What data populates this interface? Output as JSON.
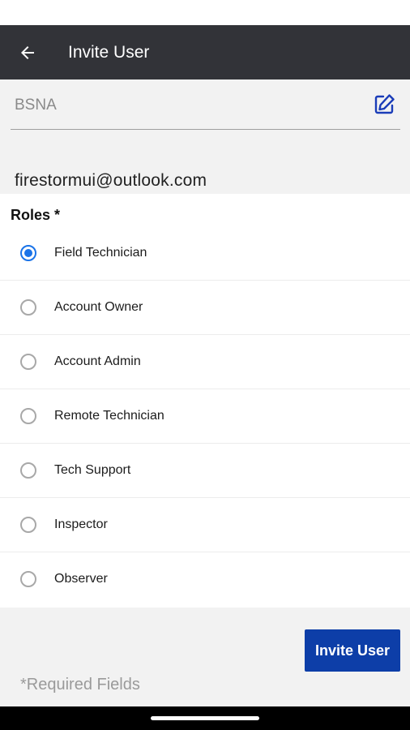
{
  "header": {
    "title": "Invite User"
  },
  "form": {
    "organization": "BSNA",
    "email": "firestormui@outlook.com"
  },
  "roles": {
    "label": "Roles *",
    "selected": "Field Technician",
    "items": [
      {
        "label": "Field Technician",
        "checked": true
      },
      {
        "label": "Account Owner",
        "checked": false
      },
      {
        "label": "Account Admin",
        "checked": false
      },
      {
        "label": "Remote Technician",
        "checked": false
      },
      {
        "label": "Tech Support",
        "checked": false
      },
      {
        "label": "Inspector",
        "checked": false
      },
      {
        "label": "Observer",
        "checked": false
      }
    ]
  },
  "actions": {
    "invite_label": "Invite User"
  },
  "footer": {
    "required_note": "*Required Fields"
  },
  "colors": {
    "app_bar": "#323338",
    "primary_button": "#0d3ea8",
    "radio_selected": "#1a73e8",
    "edit_icon": "#1a3cb8"
  },
  "icons": {
    "back": "arrow-left-icon",
    "edit": "edit-square-icon"
  }
}
